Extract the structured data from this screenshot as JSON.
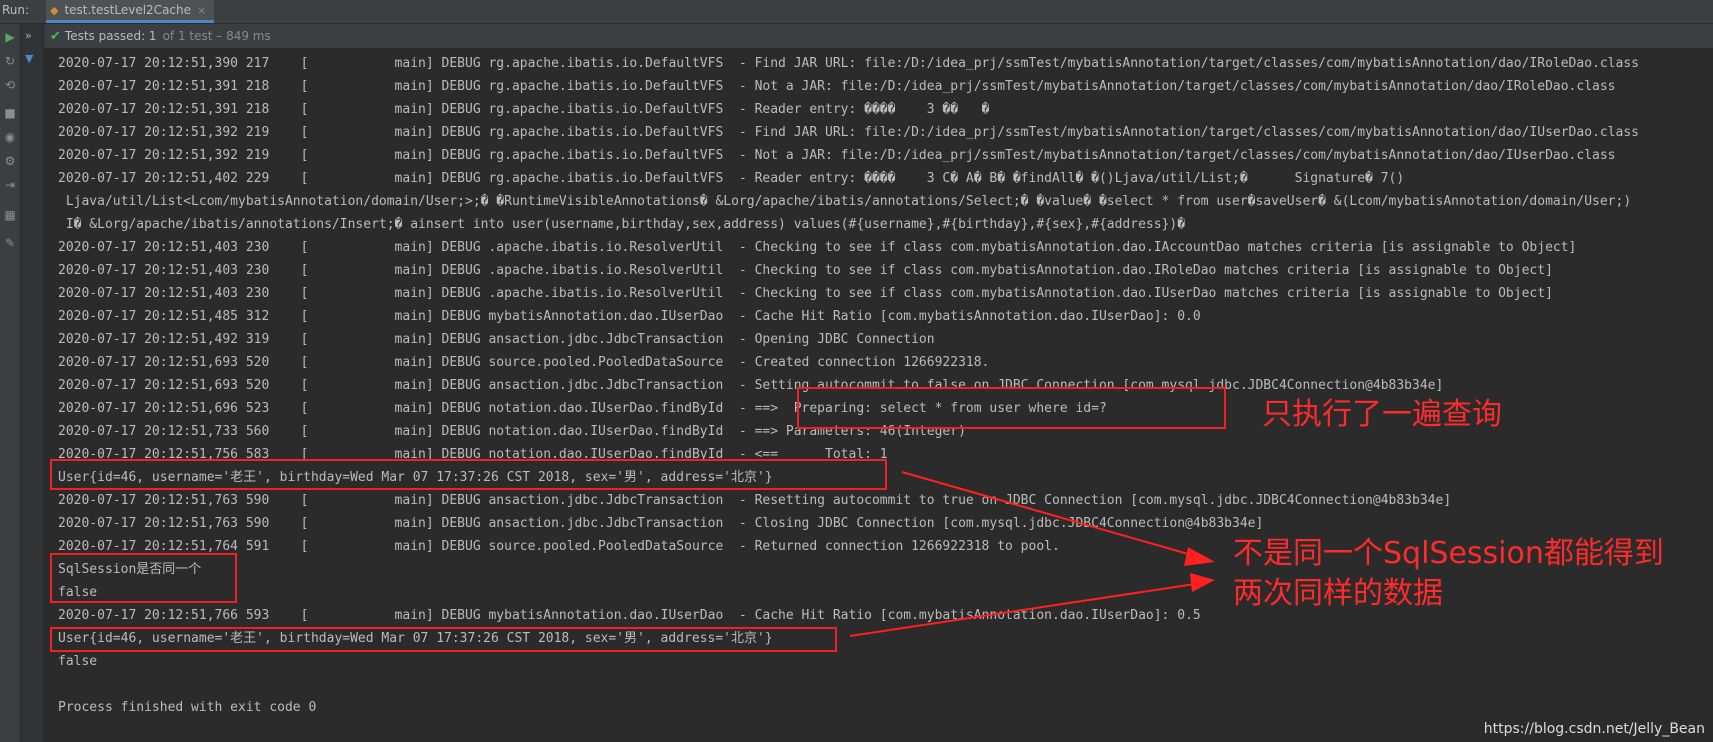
{
  "toolbar": {
    "run_label": "Run:",
    "tab_label": "test.testLevel2Cache",
    "tab_close": "×"
  },
  "status": {
    "passed_label": "Tests passed: 1",
    "detail": "of 1 test – 849 ms"
  },
  "icons": {
    "run": "play-icon",
    "rerun": "rerun-icon",
    "stop": "stop-icon",
    "settings": "camera-icon",
    "layout": "layout-icon",
    "pin": "pin-icon",
    "expand": "chevron-double-right-icon",
    "tree": "collapse-arrow-icon"
  },
  "colors": {
    "background": "#2b2b2b",
    "text": "#bbbbbb",
    "annotation": "#ff2a2a",
    "passed": "#4eb84e"
  },
  "console": {
    "lines": [
      "2020-07-17 20:12:51,390 217    [           main] DEBUG rg.apache.ibatis.io.DefaultVFS  - Find JAR URL: file:/D:/idea_prj/ssmTest/mybatisAnnotation/target/classes/com/mybatisAnnotation/dao/IRoleDao.class",
      "2020-07-17 20:12:51,391 218    [           main] DEBUG rg.apache.ibatis.io.DefaultVFS  - Not a JAR: file:/D:/idea_prj/ssmTest/mybatisAnnotation/target/classes/com/mybatisAnnotation/dao/IRoleDao.class",
      "2020-07-17 20:12:51,391 218    [           main] DEBUG rg.apache.ibatis.io.DefaultVFS  - Reader entry: ����    3 ��   �",
      "2020-07-17 20:12:51,392 219    [           main] DEBUG rg.apache.ibatis.io.DefaultVFS  - Find JAR URL: file:/D:/idea_prj/ssmTest/mybatisAnnotation/target/classes/com/mybatisAnnotation/dao/IUserDao.class",
      "2020-07-17 20:12:51,392 219    [           main] DEBUG rg.apache.ibatis.io.DefaultVFS  - Not a JAR: file:/D:/idea_prj/ssmTest/mybatisAnnotation/target/classes/com/mybatisAnnotation/dao/IUserDao.class",
      "2020-07-17 20:12:51,402 229    [           main] DEBUG rg.apache.ibatis.io.DefaultVFS  - Reader entry: ����    3 C� A� B� �findAll� �()Ljava/util/List;�      Signature� 7()",
      " Ljava/util/List<Lcom/mybatisAnnotation/domain/User;>;� �RuntimeVisibleAnnotations� &Lorg/apache/ibatis/annotations/Select;� �value� �select * from user�saveUser� &(Lcom/mybatisAnnotation/domain/User;)",
      " I� &Lorg/apache/ibatis/annotations/Insert;� ainsert into user(username,birthday,sex,address) values(#{username},#{birthday},#{sex},#{address})�",
      "2020-07-17 20:12:51,403 230    [           main] DEBUG .apache.ibatis.io.ResolverUtil  - Checking to see if class com.mybatisAnnotation.dao.IAccountDao matches criteria [is assignable to Object]",
      "2020-07-17 20:12:51,403 230    [           main] DEBUG .apache.ibatis.io.ResolverUtil  - Checking to see if class com.mybatisAnnotation.dao.IRoleDao matches criteria [is assignable to Object]",
      "2020-07-17 20:12:51,403 230    [           main] DEBUG .apache.ibatis.io.ResolverUtil  - Checking to see if class com.mybatisAnnotation.dao.IUserDao matches criteria [is assignable to Object]",
      "2020-07-17 20:12:51,485 312    [           main] DEBUG mybatisAnnotation.dao.IUserDao  - Cache Hit Ratio [com.mybatisAnnotation.dao.IUserDao]: 0.0",
      "2020-07-17 20:12:51,492 319    [           main] DEBUG ansaction.jdbc.JdbcTransaction  - Opening JDBC Connection",
      "2020-07-17 20:12:51,693 520    [           main] DEBUG source.pooled.PooledDataSource  - Created connection 1266922318.",
      "2020-07-17 20:12:51,693 520    [           main] DEBUG ansaction.jdbc.JdbcTransaction  - Setting autocommit to false on JDBC Connection [com.mysql.jdbc.JDBC4Connection@4b83b34e]",
      "2020-07-17 20:12:51,696 523    [           main] DEBUG notation.dao.IUserDao.findById  - ==>  Preparing: select * from user where id=?",
      "2020-07-17 20:12:51,733 560    [           main] DEBUG notation.dao.IUserDao.findById  - ==> Parameters: 46(Integer)",
      "2020-07-17 20:12:51,756 583    [           main] DEBUG notation.dao.IUserDao.findById  - <==      Total: 1",
      "User{id=46, username='老王', birthday=Wed Mar 07 17:37:26 CST 2018, sex='男', address='北京'}",
      "2020-07-17 20:12:51,763 590    [           main] DEBUG ansaction.jdbc.JdbcTransaction  - Resetting autocommit to true on JDBC Connection [com.mysql.jdbc.JDBC4Connection@4b83b34e]",
      "2020-07-17 20:12:51,763 590    [           main] DEBUG ansaction.jdbc.JdbcTransaction  - Closing JDBC Connection [com.mysql.jdbc.JDBC4Connection@4b83b34e]",
      "2020-07-17 20:12:51,764 591    [           main] DEBUG source.pooled.PooledDataSource  - Returned connection 1266922318 to pool.",
      "SqlSession是否同一个",
      "false",
      "2020-07-17 20:12:51,766 593    [           main] DEBUG mybatisAnnotation.dao.IUserDao  - Cache Hit Ratio [com.mybatisAnnotation.dao.IUserDao]: 0.5",
      "User{id=46, username='老王', birthday=Wed Mar 07 17:37:26 CST 2018, sex='男', address='北京'}",
      "false",
      "",
      "Process finished with exit code 0"
    ]
  },
  "annotations": {
    "note1": "只执行了一遍查询",
    "note2_line1": "不是同一个SqlSession都能得到",
    "note2_line2": "两次同样的数据"
  },
  "watermark": "https://blog.csdn.net/Jelly_Bean"
}
